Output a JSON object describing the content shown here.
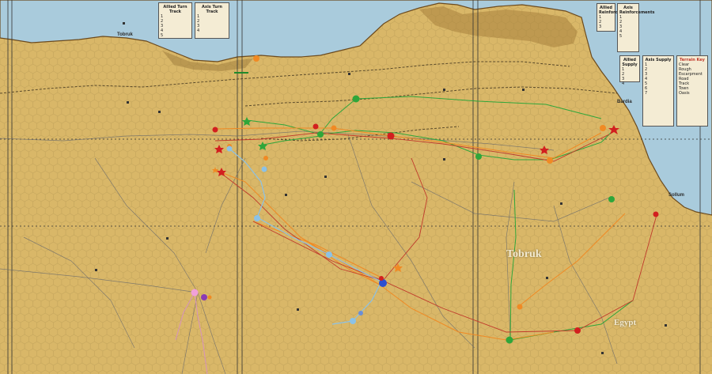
{
  "map": {
    "place_names": {
      "tobruk": "Tobruk",
      "bardia": "Bardia",
      "sollum": "Sollum",
      "tobruk_big": "Tobruk",
      "egypt_big": "Egypt"
    }
  },
  "panels": {
    "top_left_a": {
      "title": "Allied Turn Track",
      "rows": [
        "1",
        "2",
        "3",
        "4",
        "5"
      ]
    },
    "top_left_b": {
      "title": "Axis Turn Track",
      "rows": [
        "1",
        "2",
        "3",
        "4"
      ]
    },
    "top_right_a": {
      "title": "Allied Reinforcements",
      "rows": [
        "1",
        "2",
        "3"
      ]
    },
    "top_right_b": {
      "title": "Axis Reinforcements",
      "rows": [
        "1",
        "2",
        "3",
        "4",
        "5"
      ]
    },
    "right_a": {
      "title": "Allied Supply",
      "rows": [
        "1",
        "2",
        "3",
        "4"
      ]
    },
    "right_b": {
      "title": "Axis Supply",
      "rows": [
        "1",
        "2",
        "3",
        "4",
        "5",
        "6",
        "7"
      ]
    },
    "right_c": {
      "title": "Terrain Key",
      "rows": [
        "Clear",
        "Rough",
        "Escarpment",
        "Road",
        "Track",
        "Town",
        "Oasis"
      ]
    }
  },
  "colors": {
    "land": "#d9b768",
    "sea": "#a9cbdc",
    "hex_line": "#b79a54",
    "coast": "#6b4a1e",
    "red": "#d21f1f",
    "orange": "#f08a24",
    "green": "#2fa63a",
    "lightblue": "#8cc2e6",
    "blue": "#2c4fd0",
    "pink": "#f1a0d8",
    "purple": "#8a3ab5"
  }
}
